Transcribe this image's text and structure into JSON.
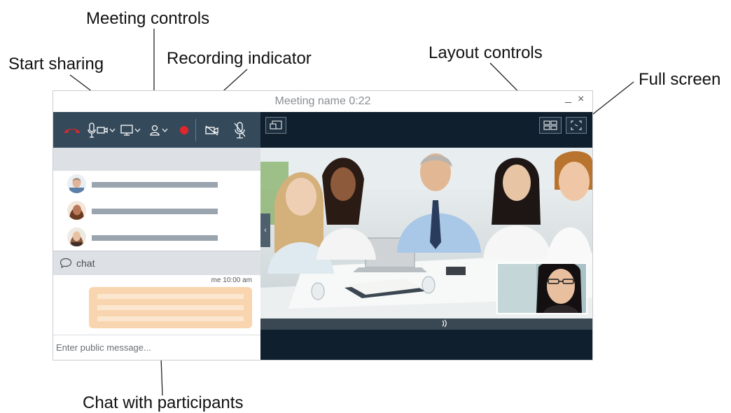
{
  "callouts": {
    "meeting_controls": "Meeting controls",
    "start_sharing": "Start sharing",
    "recording_indicator": "Recording indicator",
    "layout_controls": "Layout controls",
    "full_screen": "Full screen",
    "chat_with_participants": "Chat with participants"
  },
  "window": {
    "title": "Meeting name 0:22",
    "minimize_glyph": "_",
    "close_glyph": "×"
  },
  "toolbar": {
    "items": [
      {
        "icon": "hang-up-icon",
        "color": "#e0262a"
      },
      {
        "icon": "audio-video-icon",
        "has_menu": true
      },
      {
        "icon": "share-screen-icon",
        "has_menu": true
      },
      {
        "icon": "participants-icon",
        "has_menu": true
      },
      {
        "icon": "recording-indicator-icon",
        "color": "#e0262a"
      },
      {
        "icon": "video-off-icon"
      },
      {
        "icon": "mute-mic-icon"
      }
    ]
  },
  "participants": {
    "count": 3
  },
  "chat": {
    "header_label": "chat",
    "message_meta": "me 10:00 am",
    "input_placeholder": "Enter public message..."
  },
  "stage": {
    "collapse_glyph": "‹",
    "audio_glyph": "🔉",
    "buttons": [
      "picture-in-picture-icon",
      "grid-layout-icon",
      "fullscreen-icon"
    ]
  },
  "colors": {
    "toolbar_bg": "#34495a",
    "stage_bg": "#0f1f2d",
    "accent_red": "#e0262a",
    "bubble": "#f8d5ae",
    "panel_gray": "#dde1e5"
  }
}
